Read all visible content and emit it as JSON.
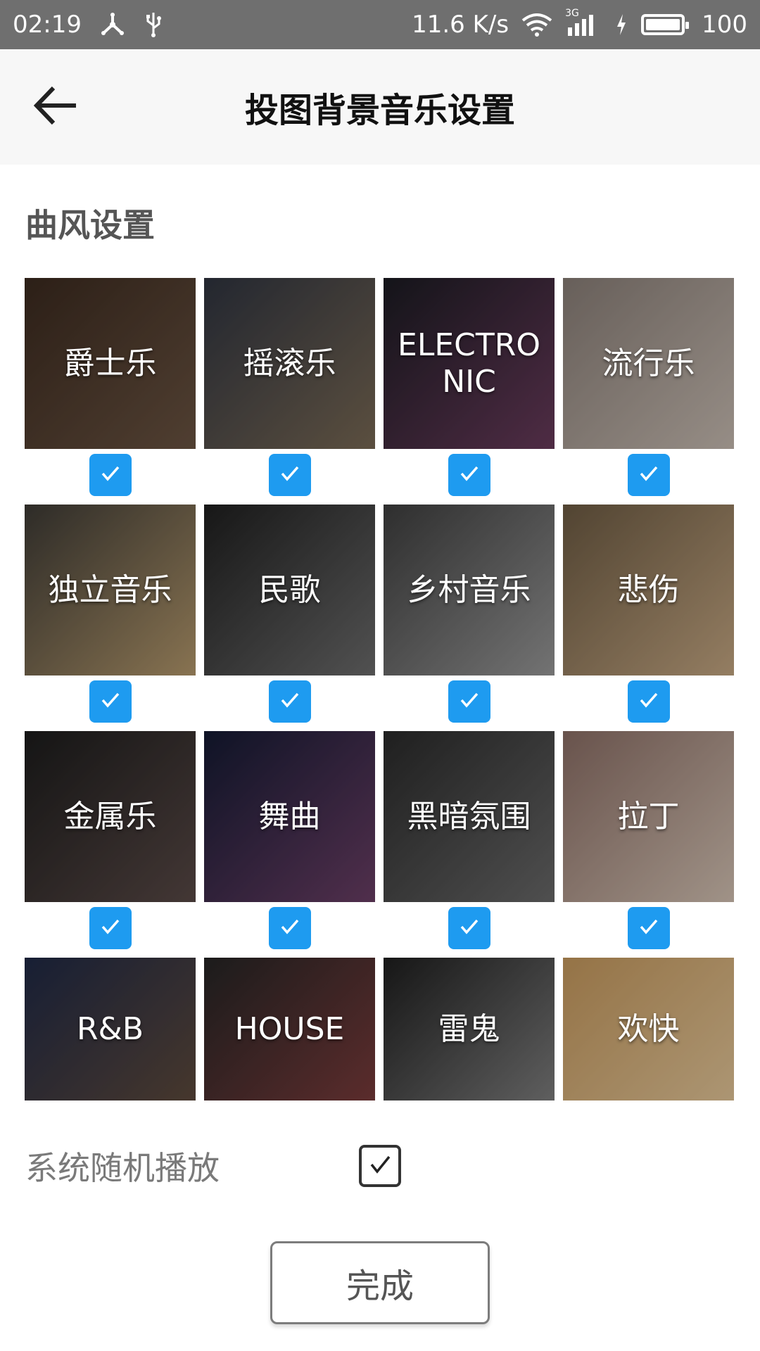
{
  "status_bar": {
    "time": "02:19",
    "network_speed": "11.6 K/s",
    "network_type": "3G",
    "battery": "100",
    "icons": [
      "usb-tether-icon",
      "usb-icon",
      "wifi-icon",
      "signal-icon",
      "charging-icon",
      "battery-icon"
    ]
  },
  "header": {
    "title": "投图背景音乐设置",
    "back_icon": "arrow-left-icon"
  },
  "section": {
    "title": "曲风设置"
  },
  "genres": [
    {
      "label": "爵士乐",
      "checked": true,
      "colors": [
        "#3b2a1f",
        "#6b5442"
      ]
    },
    {
      "label": "摇滚乐",
      "checked": true,
      "colors": [
        "#2f3440",
        "#7a6a55"
      ]
    },
    {
      "label": "ELECTRONIC",
      "checked": true,
      "colors": [
        "#1b1b22",
        "#6a3b5c"
      ]
    },
    {
      "label": "流行乐",
      "checked": true,
      "colors": [
        "#8a7f78",
        "#c9bdb3"
      ]
    },
    {
      "label": "独立音乐",
      "checked": true,
      "colors": [
        "#3d3a35",
        "#b69a6d"
      ]
    },
    {
      "label": "民歌",
      "checked": true,
      "colors": [
        "#1f1f1f",
        "#6d6d6d"
      ]
    },
    {
      "label": "乡村音乐",
      "checked": true,
      "colors": [
        "#3e3e3e",
        "#9a9a9a"
      ]
    },
    {
      "label": "悲伤",
      "checked": true,
      "colors": [
        "#6d5b43",
        "#c6a883"
      ]
    },
    {
      "label": "金属乐",
      "checked": true,
      "colors": [
        "#1c1c1c",
        "#5a4a47"
      ]
    },
    {
      "label": "舞曲",
      "checked": true,
      "colors": [
        "#141a33",
        "#6c3f66"
      ]
    },
    {
      "label": "黑暗氛围",
      "checked": true,
      "colors": [
        "#2a2a2a",
        "#6a6a6a"
      ]
    },
    {
      "label": "拉丁",
      "checked": true,
      "colors": [
        "#8c6f66",
        "#d6c4b5"
      ]
    },
    {
      "label": "R&B",
      "checked": false,
      "colors": [
        "#1f2946",
        "#5e4a3c"
      ]
    },
    {
      "label": "HOUSE",
      "checked": false,
      "colors": [
        "#252525",
        "#7a3b3b"
      ]
    },
    {
      "label": "雷鬼",
      "checked": false,
      "colors": [
        "#1e1e1e",
        "#7f7f7f"
      ]
    },
    {
      "label": "欢快",
      "checked": false,
      "colors": [
        "#c79a5e",
        "#e6c89a"
      ]
    }
  ],
  "random_play": {
    "label": "系统随机播放",
    "checked": true
  },
  "done_button": {
    "label": "完成"
  },
  "accent_color": "#1e9bf0"
}
